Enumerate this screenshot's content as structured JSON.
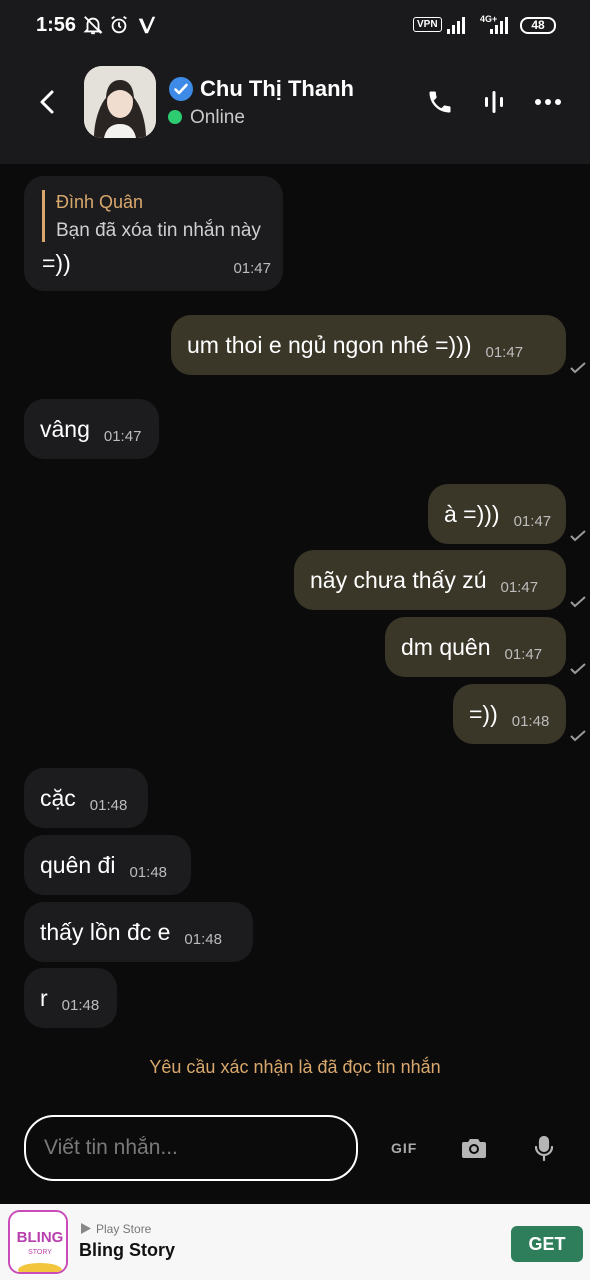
{
  "status_bar": {
    "time": "1:56",
    "vpn": "VPN",
    "network": "4G+",
    "battery": "48"
  },
  "header": {
    "contact_name": "Chu Thị Thanh",
    "presence": "Online",
    "presence_color": "#2ecc71",
    "verified_color": "#3d8be6"
  },
  "messages": {
    "reply": {
      "quoted_name": "Đình Quân",
      "quoted_text": "Bạn đã xóa tin nhắn này",
      "text": "=))",
      "time": "01:47"
    },
    "m1": {
      "text": "um thoi e ngủ ngon nhé =)))",
      "time": "01:47",
      "direction": "out"
    },
    "m2": {
      "text": "vâng",
      "time": "01:47",
      "direction": "in"
    },
    "m3": {
      "text": "à =)))",
      "time": "01:47",
      "direction": "out"
    },
    "m4": {
      "text": "nãy chưa thấy zú",
      "time": "01:47",
      "direction": "out"
    },
    "m5": {
      "text": "dm quên",
      "time": "01:47",
      "direction": "out"
    },
    "m6": {
      "text": "=))",
      "time": "01:48",
      "direction": "out"
    },
    "m7": {
      "text": "cặc",
      "time": "01:48",
      "direction": "in"
    },
    "m8": {
      "text": "quên đi",
      "time": "01:48",
      "direction": "in"
    },
    "m9": {
      "text": "thấy lồn đc e",
      "time": "01:48",
      "direction": "in"
    },
    "m10": {
      "text": "r",
      "time": "01:48",
      "direction": "in"
    }
  },
  "read_receipt_request": "Yêu cầu xác nhận là đã đọc tin nhắn",
  "composer": {
    "placeholder": "Viết tin nhắn...",
    "gif_label": "GIF"
  },
  "ad": {
    "store": "Play Store",
    "app_name": "Bling Story",
    "logo_text": "BLING",
    "logo_sub": "STORY",
    "cta": "GET",
    "cta_color": "#2e7d5b"
  },
  "colors": {
    "background": "#0b0b0c",
    "incoming_bubble": "#1c1c1f",
    "outgoing_bubble": "#3a3628",
    "accent": "#d9a86c"
  }
}
